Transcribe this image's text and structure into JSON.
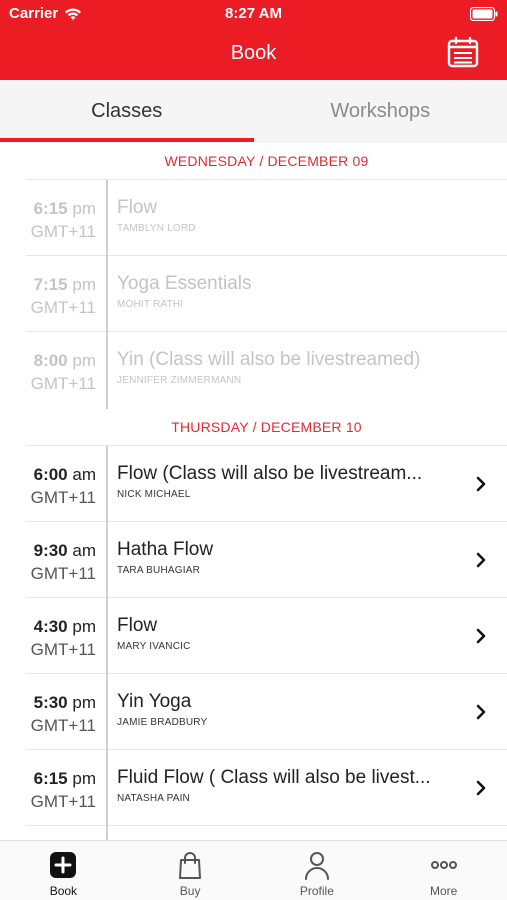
{
  "status_bar": {
    "carrier": "Carrier",
    "time": "8:27 AM"
  },
  "header": {
    "title": "Book",
    "calendar_icon": "calendar-icon",
    "color": "#ec1c24"
  },
  "tabs": [
    {
      "label": "Classes",
      "active": true
    },
    {
      "label": "Workshops",
      "active": false
    }
  ],
  "days": [
    {
      "header": "WEDNESDAY / DECEMBER 09",
      "classes": [
        {
          "time": "6:15",
          "ampm": "pm",
          "tz": "GMT+11",
          "title": "Flow",
          "instructor": "TAMBLYN LORD"
        },
        {
          "time": "7:15",
          "ampm": "pm",
          "tz": "GMT+11",
          "title": "Yoga Essentials",
          "instructor": "MOHIT RATHI"
        },
        {
          "time": "8:00",
          "ampm": "pm",
          "tz": "GMT+11",
          "title": "Yin (Class will also be livestreamed)",
          "instructor": "JENNIFER ZIMMERMANN"
        }
      ]
    },
    {
      "header": "THURSDAY / DECEMBER 10",
      "classes": [
        {
          "time": "6:00",
          "ampm": "am",
          "tz": "GMT+11",
          "title": "Flow (Class will also be livestream...",
          "instructor": "NICK MICHAEL"
        },
        {
          "time": "9:30",
          "ampm": "am",
          "tz": "GMT+11",
          "title": "Hatha Flow",
          "instructor": "TARA BUHAGIAR"
        },
        {
          "time": "4:30",
          "ampm": "pm",
          "tz": "GMT+11",
          "title": "Flow",
          "instructor": "MARY IVANCIC"
        },
        {
          "time": "5:30",
          "ampm": "pm",
          "tz": "GMT+11",
          "title": "Yin Yoga",
          "instructor": "JAMIE BRADBURY"
        },
        {
          "time": "6:15",
          "ampm": "pm",
          "tz": "GMT+11",
          "title": "Fluid Flow ( Class will also be livest...",
          "instructor": "NATASHA PAIN"
        }
      ]
    }
  ],
  "tabbar": [
    {
      "label": "Book",
      "icon": "plus-square-icon",
      "active": true
    },
    {
      "label": "Buy",
      "icon": "shopping-bag-icon",
      "active": false
    },
    {
      "label": "Profile",
      "icon": "person-icon",
      "active": false
    },
    {
      "label": "More",
      "icon": "more-dots-icon",
      "active": false
    }
  ]
}
